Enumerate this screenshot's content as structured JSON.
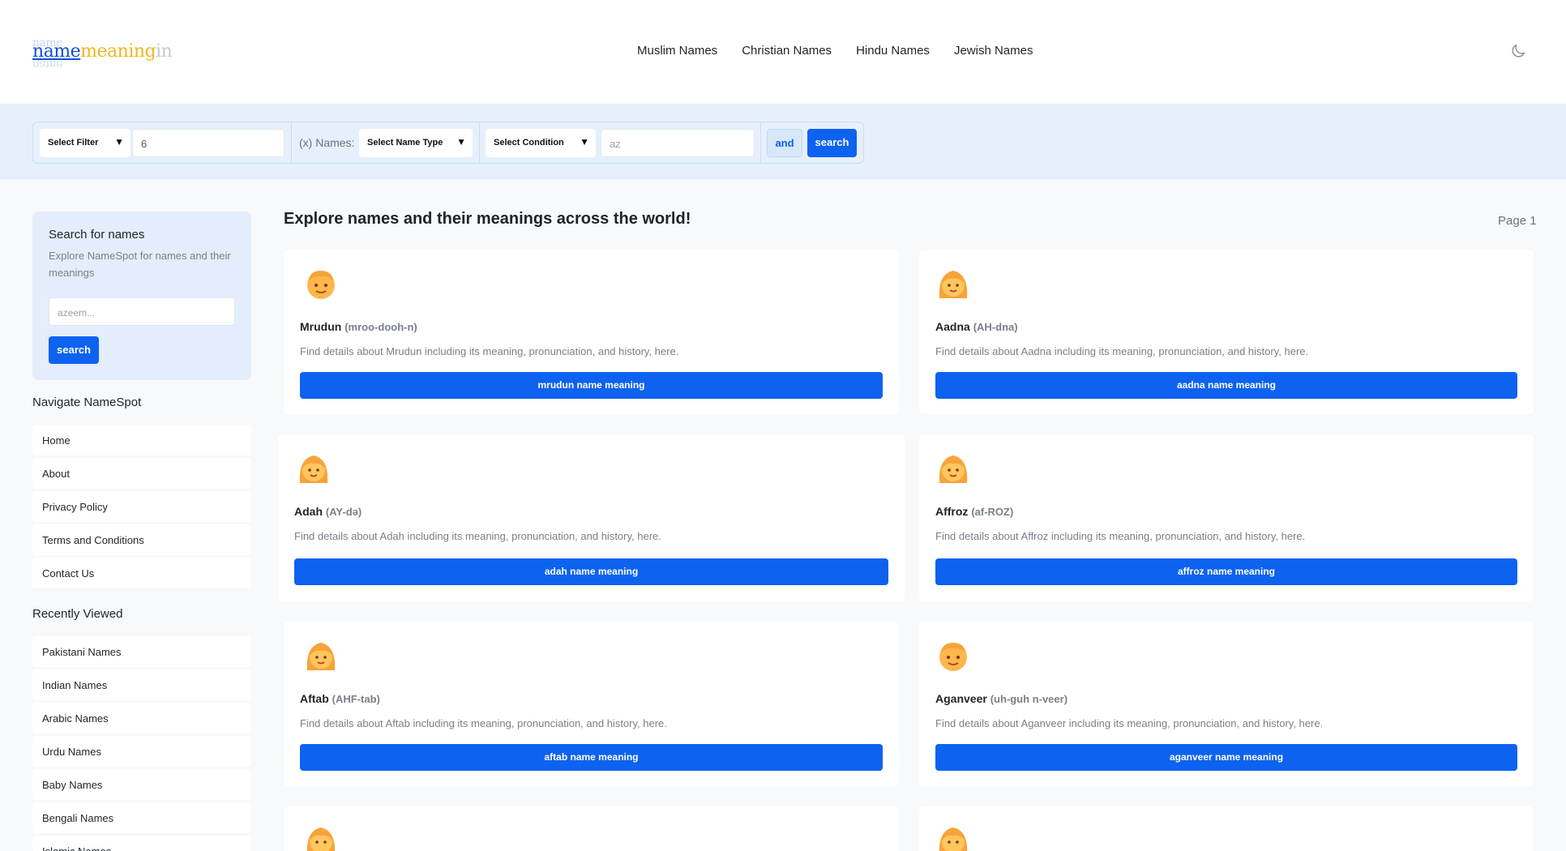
{
  "header": {
    "logo": {
      "part1": "name",
      "part2": "meaning",
      "part3": "in",
      "ghost": "name"
    },
    "nav": [
      "Muslim Names",
      "Christian Names",
      "Hindu Names",
      "Jewish Names"
    ]
  },
  "filter": {
    "filter_select": "Select Filter",
    "number_value": "6",
    "names_label": "(x) Names:",
    "name_type_select": "Select Name Type",
    "condition_select": "Select Condition",
    "letters_placeholder": "az",
    "and_label": "and",
    "search_label": "search"
  },
  "sidebar": {
    "search_title": "Search for names",
    "search_desc": "Explore NameSpot for names and their meanings",
    "search_placeholder": "azeem...",
    "search_button": "search",
    "nav_heading": "Navigate NameSpot",
    "nav_items": [
      "Home",
      "About",
      "Privacy Policy",
      "Terms and Conditions",
      "Contact Us"
    ],
    "recent_heading": "Recently Viewed",
    "recent_items": [
      "Pakistani Names",
      "Indian Names",
      "Arabic Names",
      "Urdu Names",
      "Baby Names",
      "Bengali Names",
      "Islamic Names"
    ]
  },
  "main": {
    "title": "Explore names and their meanings across the world!",
    "page_label": "Page 1",
    "cards": [
      {
        "name": "Mrudun",
        "pron": "(mroo-dooh-n)",
        "desc": "Find details about Mrudun including its meaning, pronunciation, and history, here.",
        "button": "mrudun name meaning",
        "avatar": "boy-icon"
      },
      {
        "name": "Aadna",
        "pron": "(AH-dna)",
        "desc": "Find details about Aadna including its meaning, pronunciation, and history, here.",
        "button": "aadna name meaning",
        "avatar": "girl-icon"
      },
      {
        "name": "Adah",
        "pron": "(AY-də)",
        "desc": "Find details about Adah including its meaning, pronunciation, and history, here.",
        "button": "adah name meaning",
        "avatar": "girl-icon"
      },
      {
        "name": "Affroz",
        "pron": "(af-ROZ)",
        "desc": "Find details about Affroz including its meaning, pronunciation, and history, here.",
        "button": "affroz name meaning",
        "avatar": "girl-icon"
      },
      {
        "name": "Aftab",
        "pron": "(AHF-tab)",
        "desc": "Find details about Aftab including its meaning, pronunciation, and history, here.",
        "button": "aftab name meaning",
        "avatar": "girl-icon"
      },
      {
        "name": "Aganveer",
        "pron": "(uh-guh n-veer)",
        "desc": "Find details about Aganveer including its meaning, pronunciation, and history, here.",
        "button": "aganveer name meaning",
        "avatar": "boy-icon"
      },
      {
        "avatar": "girl-icon"
      },
      {
        "avatar": "girl-icon"
      }
    ]
  }
}
